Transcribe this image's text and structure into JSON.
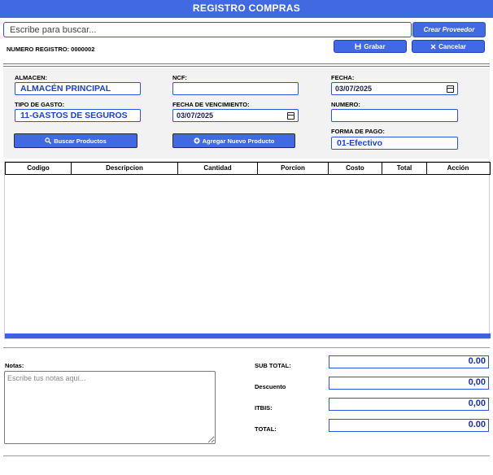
{
  "header": {
    "title": "REGISTRO COMPRAS"
  },
  "search": {
    "placeholder": "Escribe para buscar...",
    "value": ""
  },
  "toolbar": {
    "crear_proveedor": "Crear Proveedor",
    "numero_registro": "NUMERO REGISTRO: 0000002",
    "grabar": "Grabar",
    "cancelar": "Cancelar"
  },
  "form": {
    "almacen": {
      "label": "ALMACEN:",
      "value": "ALMACÉN PRINCIPAL"
    },
    "ncf": {
      "label": "NCF:",
      "value": ""
    },
    "fecha": {
      "label": "FECHA:",
      "value": "03/07/2025"
    },
    "tipo_gasto": {
      "label": "TIPO DE GASTO:",
      "value": "11-GASTOS DE SEGUROS"
    },
    "fecha_vencimiento": {
      "label": "FECHA DE VENCIMIENTO:",
      "value": "03/07/2025"
    },
    "numero": {
      "label": "NUMERO:",
      "value": ""
    },
    "forma_pago": {
      "label": "FORMA DE PAGO:",
      "value": "01-Efectivo"
    },
    "buscar_productos": "Buscar Productos",
    "agregar_producto": "Agregar Nuevo Producto"
  },
  "table": {
    "columns": [
      "Codigo",
      "Descripcion",
      "Cantidad",
      "Porcion",
      "Costo",
      "Total",
      "Acción"
    ],
    "rows": []
  },
  "notes": {
    "label": "Notas:",
    "placeholder": "Escribe tus notas aquí..."
  },
  "totals": {
    "subtotal": {
      "label": "SUB TOTAL:",
      "value": "0.00"
    },
    "descuento": {
      "label": "Descuento",
      "value": "0,00"
    },
    "itbis": {
      "label": "ITBIS:",
      "value": "0,00"
    },
    "total": {
      "label": "TOTAL:",
      "value": "0.00"
    }
  },
  "icons": {
    "grabar": "floppy-disk",
    "cancelar": "x-mark",
    "buscar": "magnifier",
    "agregar": "plus-circle",
    "calendar": "calendar"
  },
  "colors": {
    "accent": "#4169e1",
    "input_border": "#2b55d8",
    "value_text": "#1a3fd6"
  }
}
